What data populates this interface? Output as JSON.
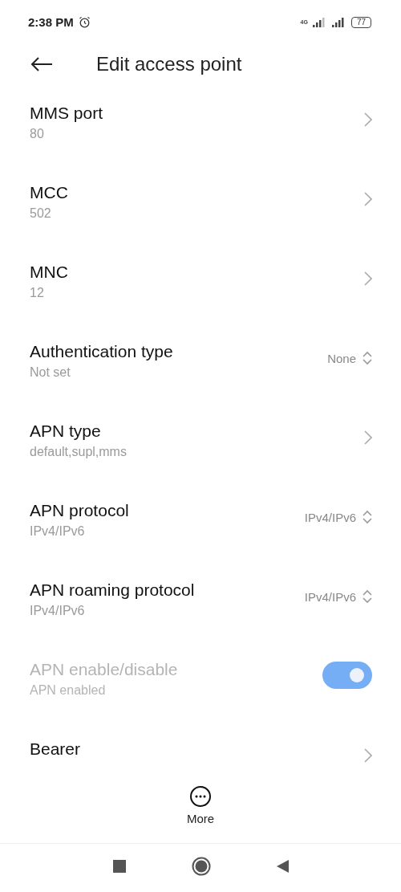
{
  "status_bar": {
    "time": "2:38 PM",
    "network": "4G",
    "battery": "77"
  },
  "header": {
    "title": "Edit access point"
  },
  "settings": [
    {
      "kind": "chevron",
      "title": "MMS port",
      "value": "80",
      "disabled": false
    },
    {
      "kind": "chevron",
      "title": "MCC",
      "value": "502",
      "disabled": false
    },
    {
      "kind": "chevron",
      "title": "MNC",
      "value": "12",
      "disabled": false
    },
    {
      "kind": "spinner",
      "title": "Authentication type",
      "value": "Not set",
      "choice": "None",
      "disabled": false
    },
    {
      "kind": "chevron",
      "title": "APN type",
      "value": "default,supl,mms",
      "disabled": false
    },
    {
      "kind": "spinner",
      "title": "APN protocol",
      "value": "IPv4/IPv6",
      "choice": "IPv4/IPv6",
      "disabled": false
    },
    {
      "kind": "spinner",
      "title": "APN roaming protocol",
      "value": "IPv4/IPv6",
      "choice": "IPv4/IPv6",
      "disabled": false
    },
    {
      "kind": "switch",
      "title": "APN enable/disable",
      "value": "APN enabled",
      "on": true,
      "disabled": true
    },
    {
      "kind": "chevron",
      "title": "Bearer",
      "disabled": false
    }
  ],
  "bottom_action": {
    "label": "More"
  }
}
